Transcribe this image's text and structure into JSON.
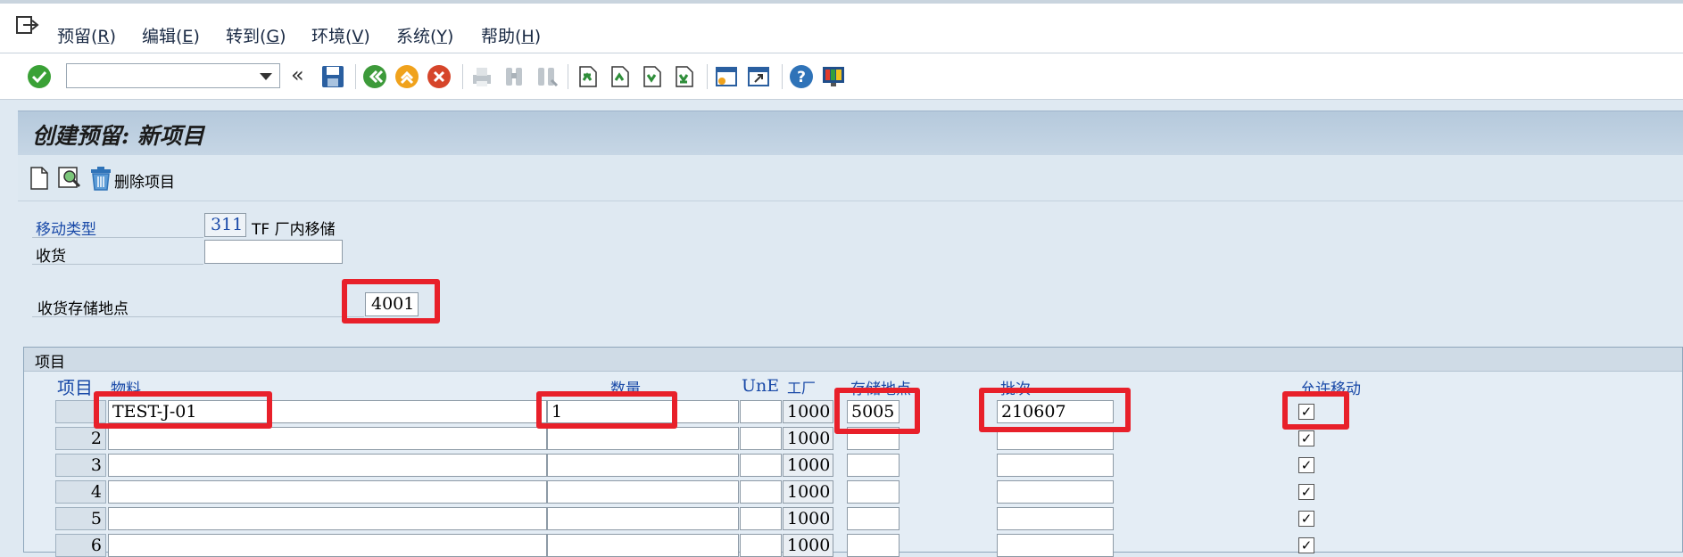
{
  "menu": {
    "items": [
      {
        "text": "预留(",
        "key": "R",
        "end": ")"
      },
      {
        "text": "编辑(",
        "key": "E",
        "end": ")"
      },
      {
        "text": "转到(",
        "key": "G",
        "end": ")"
      },
      {
        "text": "环境(",
        "key": "V",
        "end": ")"
      },
      {
        "text": "系统(",
        "key": "Y",
        "end": ")"
      },
      {
        "text": "帮助(",
        "key": "H",
        "end": ")"
      }
    ]
  },
  "toolbar": {
    "command_value": "",
    "back_glyph": "«"
  },
  "page": {
    "title": "创建预留: 新项目",
    "delete_item_label": "删除项目"
  },
  "header": {
    "movement_type_label": "移动类型",
    "movement_type_value": "311",
    "movement_type_desc": "TF 厂内移储",
    "goods_recipient_label": "收货",
    "goods_recipient_value": "",
    "receiving_sloc_label": "收货存储地点",
    "receiving_sloc_value": "4001"
  },
  "items": {
    "title": "项目",
    "columns": {
      "item": "项目",
      "material": "物料",
      "quantity": "数量",
      "unit": "UnE",
      "plant": "工厂",
      "sloc": "存储地点",
      "batch": "批次",
      "allow_movement": "允许移动"
    },
    "rows": [
      {
        "num": "",
        "material": "TEST-J-01",
        "quantity": "1",
        "unit": "",
        "plant": "1000",
        "sloc": "5005",
        "batch": "210607",
        "allowed": "✓"
      },
      {
        "num": "2",
        "material": "",
        "quantity": "",
        "unit": "",
        "plant": "1000",
        "sloc": "",
        "batch": "",
        "allowed": "✓"
      },
      {
        "num": "3",
        "material": "",
        "quantity": "",
        "unit": "",
        "plant": "1000",
        "sloc": "",
        "batch": "",
        "allowed": "✓"
      },
      {
        "num": "4",
        "material": "",
        "quantity": "",
        "unit": "",
        "plant": "1000",
        "sloc": "",
        "batch": "",
        "allowed": "✓"
      },
      {
        "num": "5",
        "material": "",
        "quantity": "",
        "unit": "",
        "plant": "1000",
        "sloc": "",
        "batch": "",
        "allowed": "✓"
      },
      {
        "num": "6",
        "material": "",
        "quantity": "",
        "unit": "",
        "plant": "1000",
        "sloc": "",
        "batch": "",
        "allowed": "✓"
      }
    ]
  },
  "colors": {
    "highlight": "#e8202a",
    "label_blue": "#1a4aa8"
  }
}
